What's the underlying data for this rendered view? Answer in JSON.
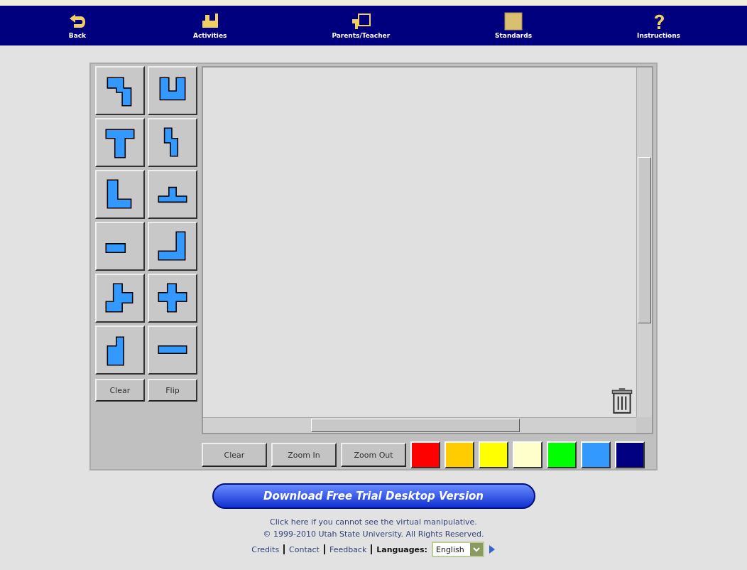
{
  "nav": [
    {
      "label": "Back"
    },
    {
      "label": "Activities"
    },
    {
      "label": "Parents/Teacher"
    },
    {
      "label": "Standards"
    },
    {
      "label": "Instructions"
    }
  ],
  "piece_buttons": [
    "Clear",
    "Flip"
  ],
  "canvas_buttons": [
    "Clear",
    "Zoom In",
    "Zoom Out"
  ],
  "colors": [
    {
      "color": "#ff0000",
      "selected": false
    },
    {
      "color": "#ffcc00",
      "selected": false
    },
    {
      "color": "#ffff00",
      "selected": false
    },
    {
      "color": "#ffffcc",
      "selected": false
    },
    {
      "color": "#00ff00",
      "selected": false
    },
    {
      "color": "#3399ff",
      "selected": false
    },
    {
      "color": "#000080",
      "selected": false
    }
  ],
  "download_button": "Download Free Trial Desktop Version",
  "footer": {
    "notice": "Click here if you cannot see the virtual manipulative.",
    "copyright": "© 1999-2010 Utah State University. All Rights Reserved.",
    "links": [
      "Credits",
      "Contact",
      "Feedback"
    ],
    "languages_label": "Languages:",
    "language": "English"
  }
}
